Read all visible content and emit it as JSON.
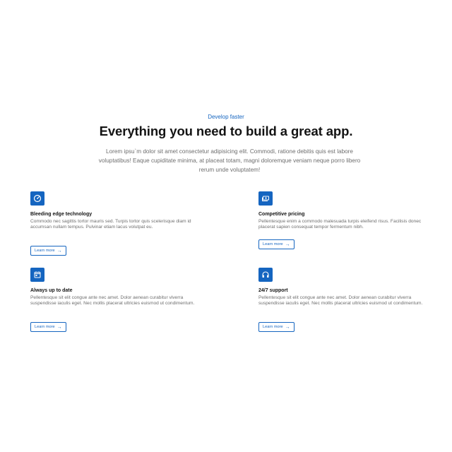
{
  "section": {
    "eyebrow": "Develop faster",
    "headline": "Everything you need to build a great app.",
    "lead": "Lorem ipsu`m dolor sit amet consectetur adipisicing elit. Commodi, ratione debitis quis est labore voluptatibus! Eaque cupiditate minima, at placeat totam, magni doloremque veniam neque porro libero rerum unde voluptatem!"
  },
  "features": [
    {
      "icon": "speedometer-icon",
      "title": "Bleeding edge technology",
      "description": "Commodo nec sagittis tortor mauris sed. Turpis tortor quis scelerisque diam id accumsan nullam tempus. Pulvinar etiam lacus volutpat eu.",
      "button_label": "Learn more",
      "button_icon": "arrow-right-icon"
    },
    {
      "icon": "money-icon",
      "title": "Competitive pricing",
      "description": "Pellentesque enim a commodo malesuada turpis eleifend risus. Facilisis donec placerat sapien consequat tempor fermentum nibh.",
      "button_label": "Learn more",
      "button_icon": "arrow-right-icon"
    },
    {
      "icon": "calendar-icon",
      "title": "Always up to date",
      "description": "Pellentesque sit elit congue ante nec amet. Dolor aenean curabitur viverra suspendisse iaculis eget. Nec mollis placerat ultricies euismod ut condimentum.",
      "button_label": "Learn more",
      "button_icon": "arrow-right-icon"
    },
    {
      "icon": "headset-icon",
      "title": "24/7 support",
      "description": "Pellentesque sit elit congue ante nec amet. Dolor aenean curabitur viverra suspendisse iaculis eget. Nec mollis placerat ultricies euismod ut condimentum.",
      "button_label": "Learn more",
      "button_icon": "arrow-right-icon"
    }
  ],
  "colors": {
    "accent": "#1565c0",
    "heading": "#141414",
    "body_text": "#6e6e6e",
    "background": "#ffffff"
  }
}
